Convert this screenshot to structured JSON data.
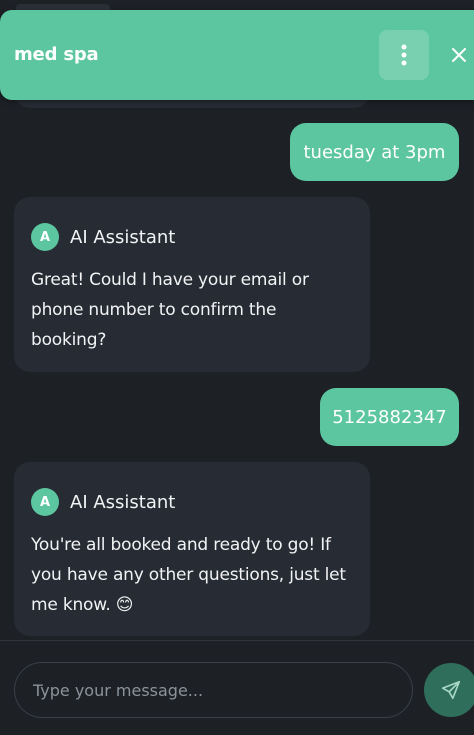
{
  "header": {
    "title": "med spa",
    "menu_icon": "vertical-dots-icon",
    "close_icon": "close-icon"
  },
  "messages": [
    {
      "role": "user",
      "text": "tuesday at 3pm"
    },
    {
      "role": "assistant",
      "avatar_letter": "A",
      "sender": "AI Assistant",
      "text": "Great! Could I have your email or phone number to confirm the booking?"
    },
    {
      "role": "user",
      "text": "5125882347"
    },
    {
      "role": "assistant",
      "avatar_letter": "A",
      "sender": "AI Assistant",
      "text": "You're all booked and ready to go! If you have any other questions, just let me know. 😊"
    }
  ],
  "composer": {
    "placeholder": "Type your message...",
    "value": "",
    "send_icon": "send-icon"
  },
  "colors": {
    "accent": "#5cc6a0",
    "background": "#1d2126",
    "bubble": "#272b33",
    "send_button": "#2f6e5a"
  }
}
